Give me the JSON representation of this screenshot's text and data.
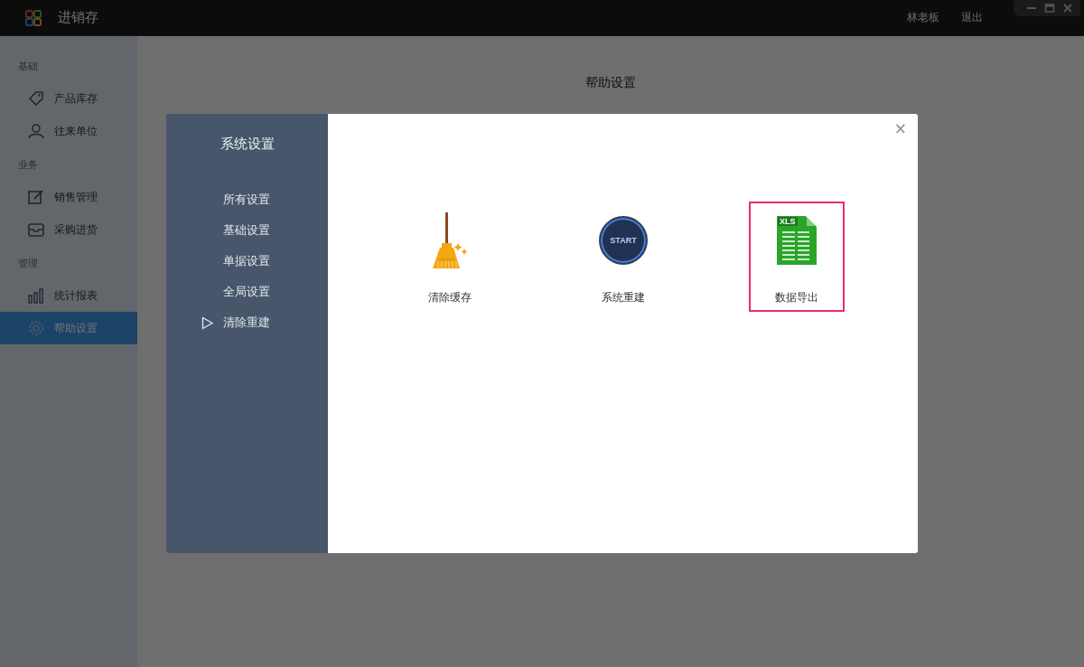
{
  "window": {
    "title": "进销存",
    "user": "林老板",
    "logout": "退出"
  },
  "sidebar": {
    "groups": [
      {
        "label": "基础",
        "items": [
          {
            "label": "产品库存",
            "kind": "tag",
            "selected": false
          },
          {
            "label": "往来单位",
            "kind": "user",
            "selected": false
          }
        ]
      },
      {
        "label": "业务",
        "items": [
          {
            "label": "销售管理",
            "kind": "edit",
            "selected": false
          },
          {
            "label": "采购进货",
            "kind": "inbox",
            "selected": false
          }
        ]
      },
      {
        "label": "管理",
        "items": [
          {
            "label": "统计报表",
            "kind": "chart",
            "selected": false
          },
          {
            "label": "帮助设置",
            "kind": "gear",
            "selected": true
          }
        ]
      }
    ]
  },
  "page": {
    "title": "帮助设置"
  },
  "dialog": {
    "title": "系统设置",
    "close": "×",
    "menu": [
      {
        "label": "所有设置",
        "selected": false
      },
      {
        "label": "基础设置",
        "selected": false
      },
      {
        "label": "单据设置",
        "selected": false
      },
      {
        "label": "全局设置",
        "selected": false
      },
      {
        "label": "清除重建",
        "selected": true
      }
    ],
    "actions": [
      {
        "label": "清除缓存",
        "kind": "broom",
        "selected": false
      },
      {
        "label": "系统重建",
        "kind": "start",
        "badge": "START",
        "selected": false
      },
      {
        "label": "数据导出",
        "kind": "xls",
        "badge": "XLS",
        "selected": true
      }
    ]
  }
}
